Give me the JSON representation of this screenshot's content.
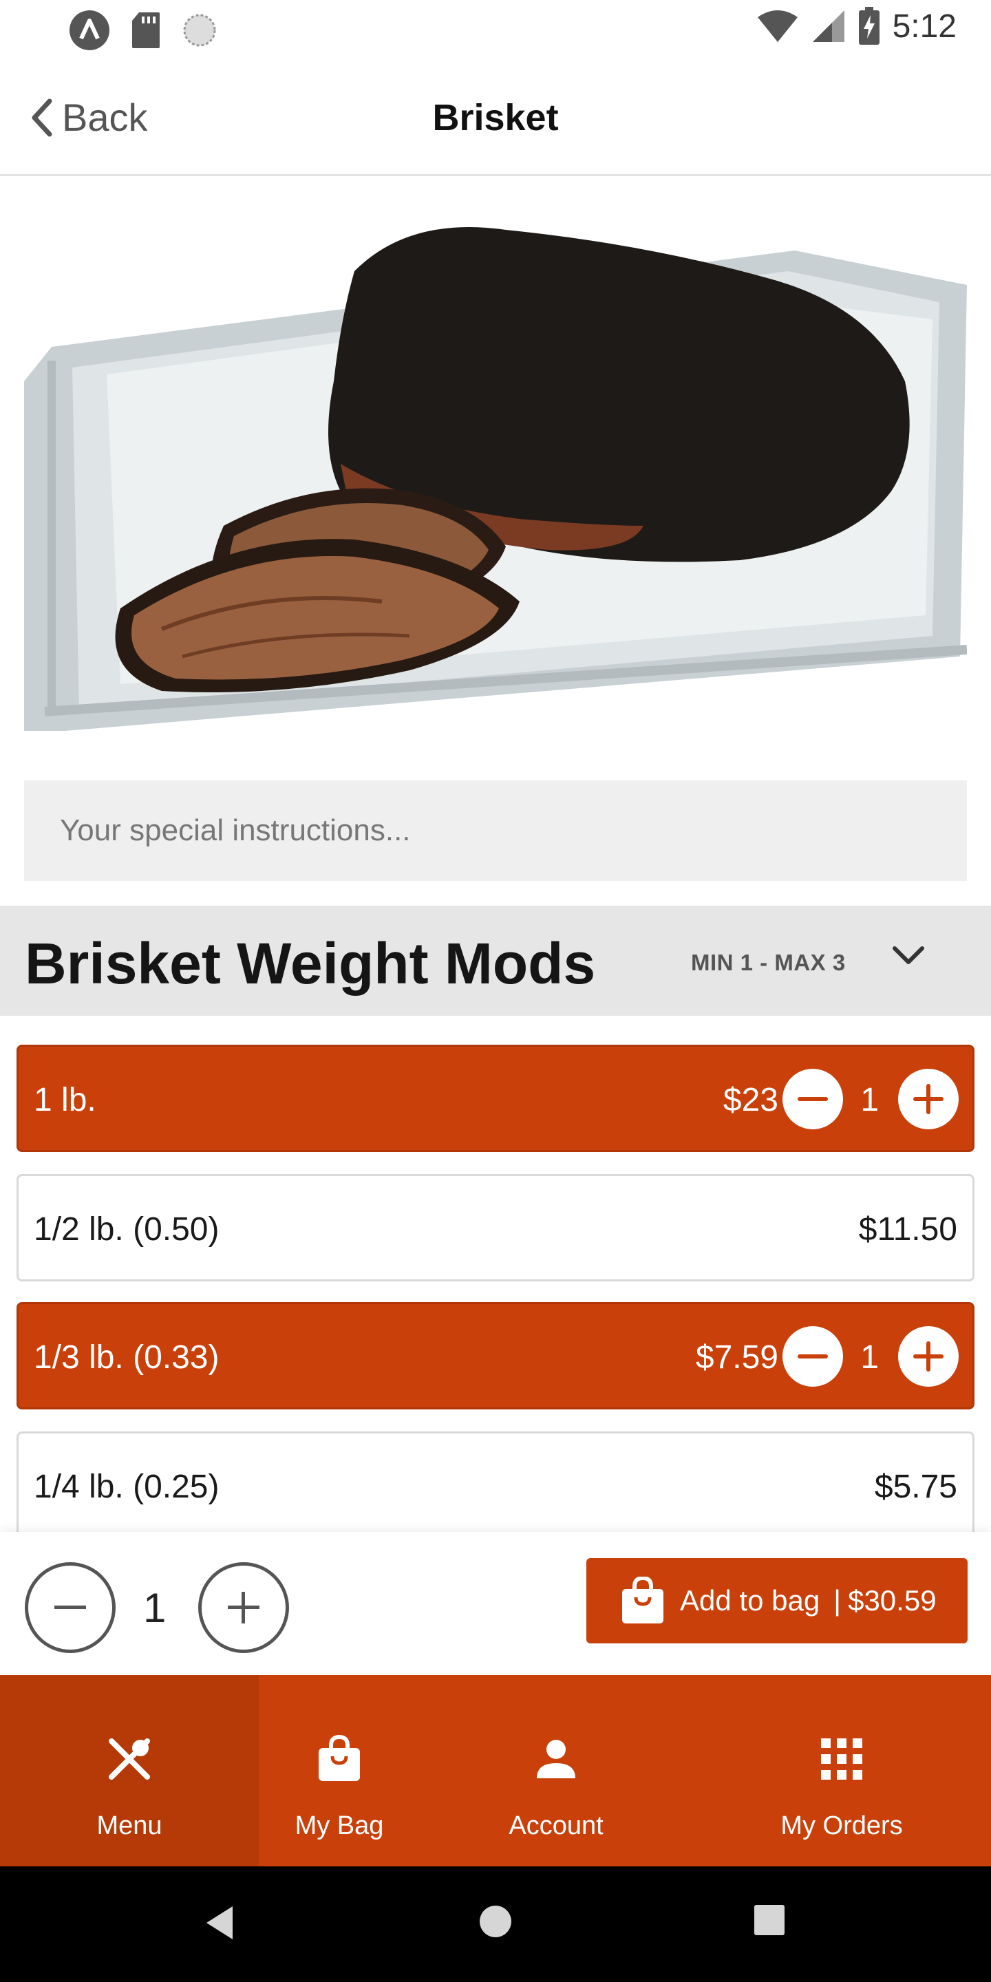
{
  "status_bar": {
    "time": "5:12",
    "left_icons": [
      "a-circle-icon",
      "sd-card-icon",
      "sync-icon"
    ],
    "right_icons": [
      "wifi-icon",
      "cell-signal-icon",
      "battery-charging-icon"
    ]
  },
  "app_bar": {
    "back_label": "Back",
    "title": "Brisket"
  },
  "hero_image": {
    "subject": "sliced smoked brisket on a tray"
  },
  "instructions": {
    "placeholder": "Your special instructions...",
    "value": ""
  },
  "section": {
    "title": "Brisket Weight Mods",
    "range": "MIN 1 - MAX 3"
  },
  "options": [
    {
      "label": "1 lb.",
      "price": "$23",
      "selected": true,
      "qty": "1"
    },
    {
      "label": "1/2 lb.  (0.50)",
      "price": "$11.50",
      "selected": false
    },
    {
      "label": "1/3 lb.  (0.33)",
      "price": "$7.59",
      "selected": true,
      "qty": "1"
    },
    {
      "label": "1/4 lb.  (0.25)",
      "price": "$5.75",
      "selected": false
    }
  ],
  "action_bar": {
    "quantity": "1",
    "add_label": "Add to bag",
    "separator": "|",
    "total": "$30.59"
  },
  "bottom_nav": [
    {
      "label": "Menu",
      "icon": "utensils-icon",
      "active": true
    },
    {
      "label": "My Bag",
      "icon": "bag-icon",
      "active": false
    },
    {
      "label": "Account",
      "icon": "person-icon",
      "active": false
    },
    {
      "label": "My Orders",
      "icon": "grid-icon",
      "active": false
    }
  ],
  "colors": {
    "accent": "#c9400a",
    "accent_dark": "#b53a07",
    "section_bg": "#e6e6e6",
    "input_bg": "#efefef"
  }
}
